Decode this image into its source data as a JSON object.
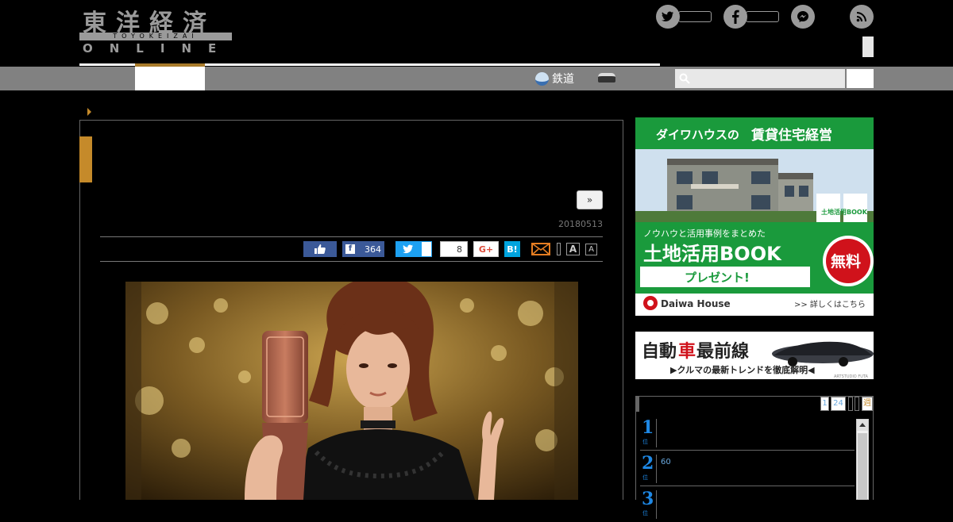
{
  "header": {
    "logo_jp": "東洋経済",
    "logo_sub": "TOYOKEIZAI",
    "logo_en": "ONLINE",
    "social": [
      {
        "name": "twitter",
        "glyph": "t"
      },
      {
        "name": "facebook",
        "glyph": "f"
      },
      {
        "name": "messenger",
        "glyph": "m"
      },
      {
        "name": "rss",
        "glyph": "r"
      }
    ]
  },
  "nav": {
    "rail_label": "鉄道",
    "search_placeholder": ""
  },
  "article": {
    "next_label": "»",
    "date": "20180513",
    "share": {
      "facebook_count": "364",
      "pocket_count": "8",
      "gplus_label": "G+",
      "hatena_label": "B!"
    },
    "font_large": "A",
    "font_small": "A"
  },
  "sidebar": {
    "ad1": {
      "headline_a": "ダイワハウスの",
      "headline_b": "賃貸住宅経営",
      "book_small": "土地活用BOOK",
      "know_how": "ノウハウと活用事例をまとめた",
      "book_title": "土地活用BOOK",
      "present": "プレゼント!",
      "free": "無料",
      "brand": "Daiwa House",
      "more": ">> 詳しくはこちら",
      "colors": {
        "green": "#1a9a3c",
        "red": "#d0121b"
      }
    },
    "ad2": {
      "title_a": "自動",
      "title_red": "車",
      "title_b": "最前線",
      "subtitle": "▶クルマの最新トレンドを徹底解明◀",
      "credit": "ARTSTUDIO FUTA"
    },
    "ranking": {
      "tabs": [
        "1",
        "24",
        "",
        "",
        "週"
      ],
      "rows": [
        {
          "num": "1",
          "suffix": "位",
          "text": ""
        },
        {
          "num": "2",
          "suffix": "位",
          "text": "60"
        },
        {
          "num": "3",
          "suffix": "位",
          "text": ""
        }
      ]
    }
  }
}
